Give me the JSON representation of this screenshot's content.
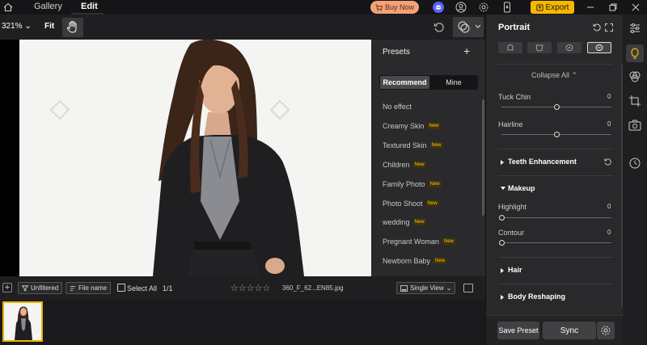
{
  "topbar": {
    "tabs": [
      "Gallery",
      "Edit"
    ],
    "buy_now": "Buy Now",
    "export": "Export"
  },
  "toolbar": {
    "zoom": "321%",
    "fit": "Fit"
  },
  "presets": {
    "title": "Presets",
    "tabs": [
      "Recommend",
      "Mine"
    ],
    "new_label": "New",
    "items": [
      {
        "label": "No effect",
        "is_new": false
      },
      {
        "label": "Creamy Skin",
        "is_new": true
      },
      {
        "label": "Textured Skin",
        "is_new": true
      },
      {
        "label": "Children",
        "is_new": true
      },
      {
        "label": "Family Photo",
        "is_new": true
      },
      {
        "label": "Photo Shoot",
        "is_new": true
      },
      {
        "label": "wedding",
        "is_new": true
      },
      {
        "label": "Pregnant Woman",
        "is_new": true
      },
      {
        "label": "Newborn Baby",
        "is_new": true
      }
    ]
  },
  "filterbar": {
    "unfiltered": "Unfiltered",
    "file_name": "File name",
    "select_all": "Select All",
    "count": "1/1",
    "stars": "☆☆☆☆☆",
    "filename": "360_F_62...EN85.jpg",
    "view": "Single View"
  },
  "filmstrip": {
    "thumb_index": "1"
  },
  "right_panel": {
    "title": "Portrait",
    "collapse_all": "Collapse All",
    "sliders": [
      {
        "label": "Tuck Chin",
        "value": "0",
        "level": 0.5
      },
      {
        "label": "Hairline",
        "value": "0",
        "level": 0.5
      },
      {
        "label": "Highlight",
        "value": "0",
        "level": 0.0
      },
      {
        "label": "Contour",
        "value": "0",
        "level": 0.0
      }
    ],
    "sections": {
      "teeth": "Teeth Enhancement",
      "makeup": "Makeup",
      "hair": "Hair",
      "body": "Body Reshaping"
    },
    "save_preset": "Save Preset",
    "sync": "Sync"
  },
  "colors": {
    "accent_yellow": "#f5b700",
    "buy_now_bg": "#f3a27a",
    "new_badge": "#ffc000",
    "discord": "#5865f2"
  }
}
